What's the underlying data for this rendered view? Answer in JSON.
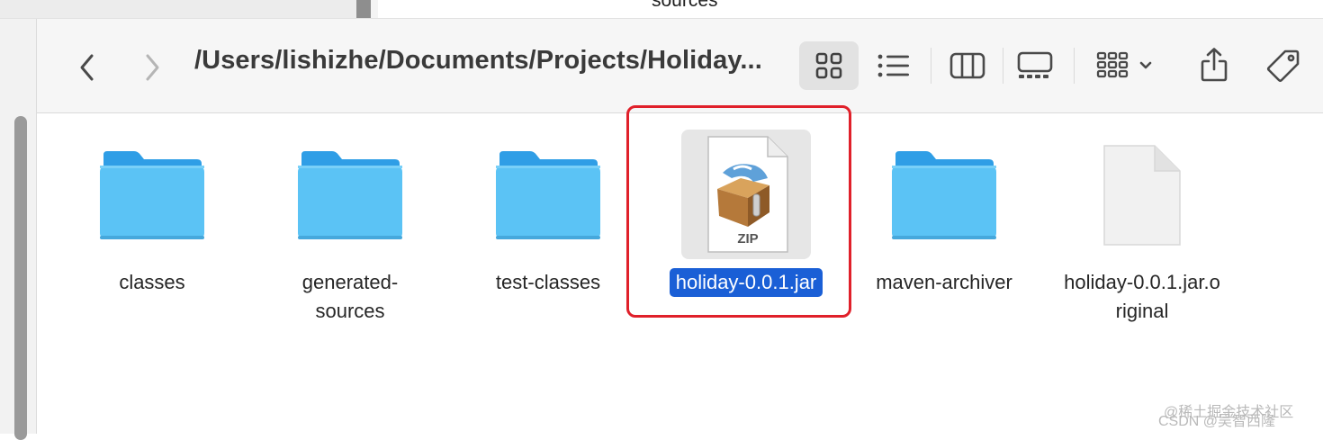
{
  "top_strip": {
    "partial_text": "sources"
  },
  "toolbar": {
    "path": "/Users/lishizhe/Documents/Projects/Holiday...",
    "icons": {
      "back": "chevron-left-icon",
      "forward": "chevron-right-icon",
      "icon_view": "grid-icon",
      "list_view": "list-icon",
      "column_view": "columns-icon",
      "gallery_view": "gallery-icon",
      "group": "group-icon",
      "share": "share-icon",
      "tag": "tag-icon"
    },
    "active_view": "icon_view"
  },
  "files": [
    {
      "name_lines": [
        "classes"
      ],
      "kind": "folder",
      "selected": false
    },
    {
      "name_lines": [
        "generated-",
        "sources"
      ],
      "kind": "folder",
      "selected": false
    },
    {
      "name_lines": [
        "test-classes"
      ],
      "kind": "folder",
      "selected": false
    },
    {
      "name_lines": [
        "holiday-0.0.1.jar"
      ],
      "kind": "zip",
      "selected": true,
      "icon_text": "ZIP"
    },
    {
      "name_lines": [
        "maven-archiver"
      ],
      "kind": "folder",
      "selected": false
    },
    {
      "name_lines": [
        "holiday-0.0.1.jar.o",
        "riginal"
      ],
      "kind": "document",
      "selected": false
    }
  ],
  "watermarks": {
    "line1": "@稀土掘金技术社区",
    "line2": "CSDN @吴智西隆"
  },
  "colors": {
    "folder_top": "#2f9ee6",
    "folder_body": "#5bc3f5",
    "selection": "#1a5fd6",
    "highlight_box": "#e0202a"
  }
}
